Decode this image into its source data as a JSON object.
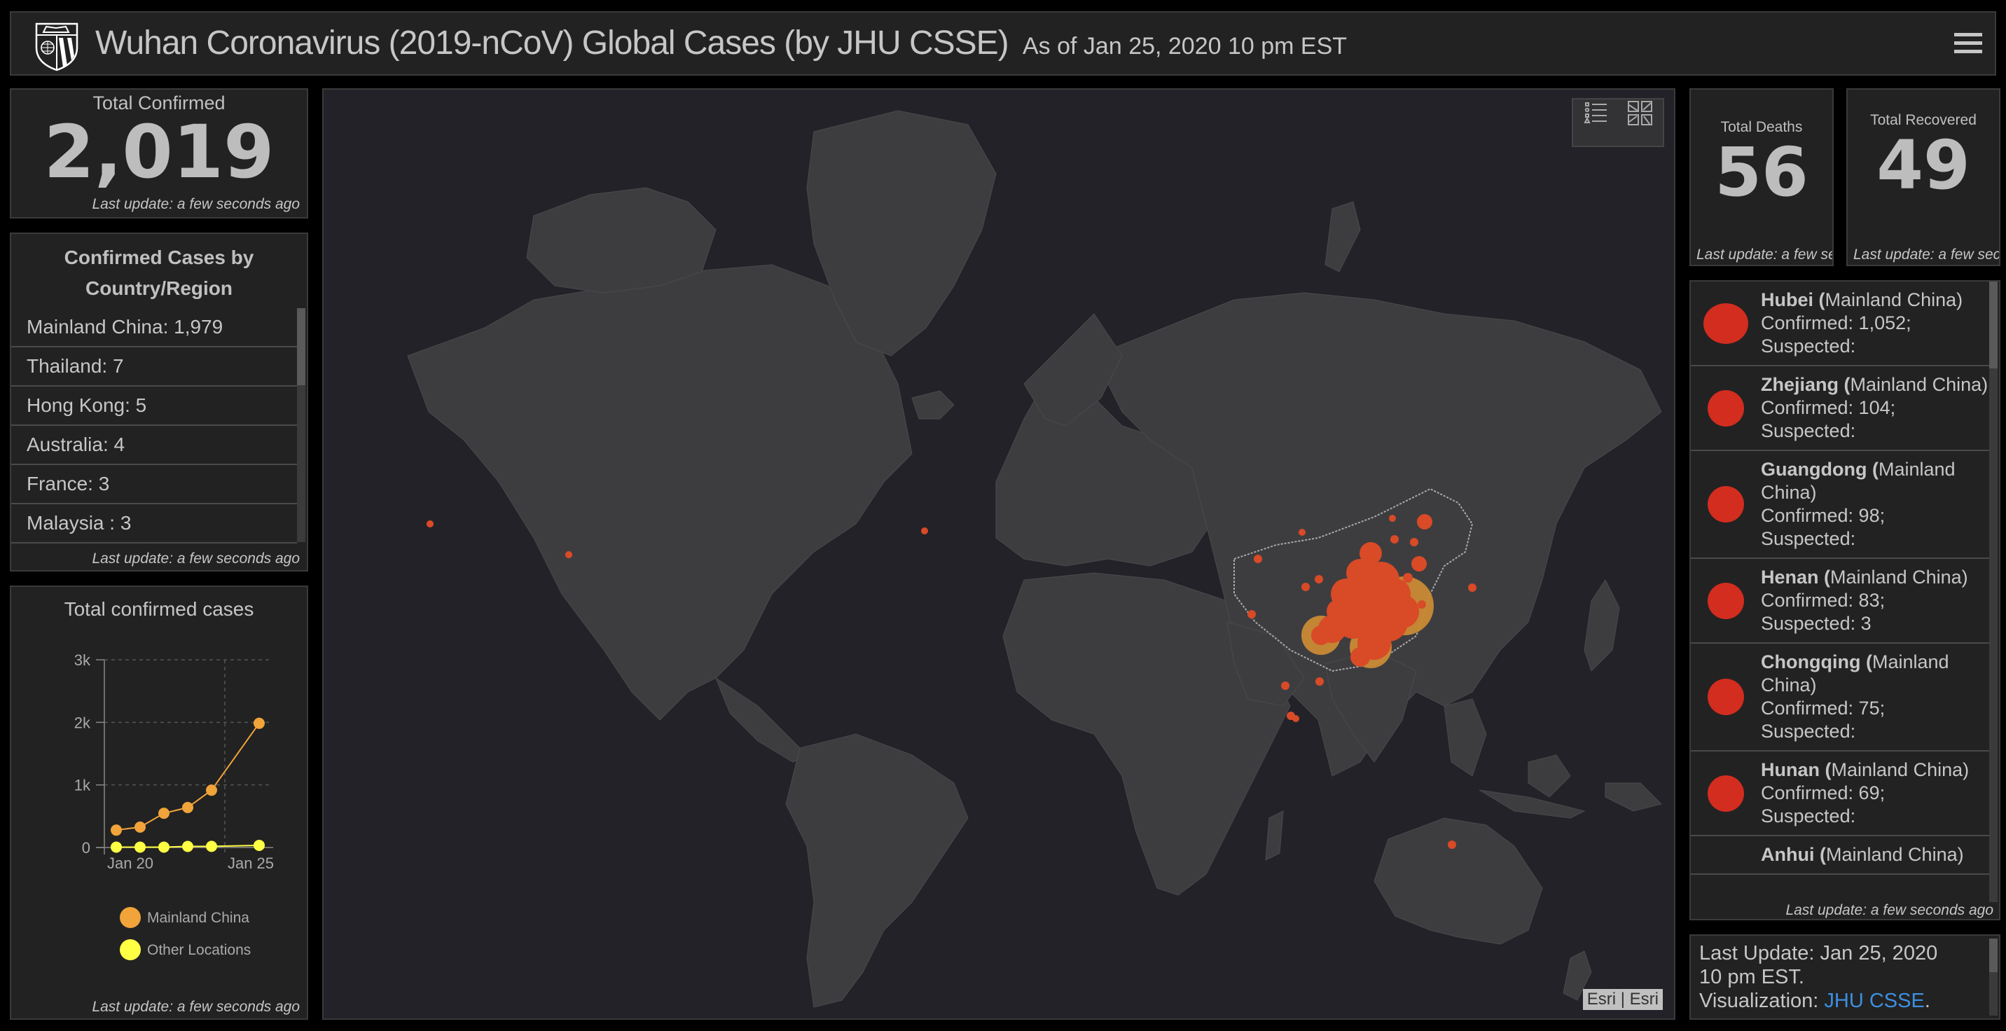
{
  "header": {
    "title": "Wuhan Coronavirus (2019-nCoV) Global Cases (by JHU CSSE)",
    "subtitle": "As of Jan 25, 2020 10 pm EST",
    "logo_icon": "jhu-shield-logo",
    "menu_icon": "hamburger-menu-icon"
  },
  "total_confirmed": {
    "label": "Total Confirmed",
    "value": "2,019",
    "update": "Last update: a few seconds ago"
  },
  "country_list": {
    "title": "Confirmed Cases by Country/Region",
    "items": [
      {
        "label": "Mainland China:  1,979"
      },
      {
        "label": "Thailand:  7"
      },
      {
        "label": "Hong Kong:  5"
      },
      {
        "label": "Australia:  4"
      },
      {
        "label": "France:  3"
      },
      {
        "label": "Malaysia :  3"
      }
    ],
    "update": "Last update: a few seconds ago"
  },
  "chart_panel": {
    "update": "Last update: a few seconds ago"
  },
  "chart_data": {
    "type": "line",
    "title": "Total confirmed cases",
    "xlabel": "",
    "ylabel": "",
    "x": [
      "Jan 20",
      "Jan 21",
      "Jan 22",
      "Jan 23",
      "Jan 24",
      "Jan 25"
    ],
    "x_tick_labels": [
      "Jan 20",
      "Jan 25"
    ],
    "y_tick_labels": [
      "0",
      "1k",
      "2k",
      "3k"
    ],
    "ylim": [
      0,
      3000
    ],
    "grid": true,
    "legend_position": "bottom",
    "series": [
      {
        "name": "Mainland China",
        "color": "#f1a43a",
        "values": [
          278,
          326,
          547,
          639,
          916,
          1985
        ]
      },
      {
        "name": "Other Locations",
        "color": "#ffff44",
        "values": [
          6,
          6,
          6,
          17,
          18,
          34
        ]
      }
    ]
  },
  "map": {
    "widgets": [
      {
        "name": "legend-widget",
        "icon": "legend-list-icon"
      },
      {
        "name": "basemap-gallery-widget",
        "icon": "basemap-gallery-icon"
      }
    ],
    "attribution": "Esri | Esri",
    "colors": {
      "land": "#3d3d40",
      "water": "#222228",
      "case_marker": "#d94a27",
      "suspected_marker": "#c98a35"
    }
  },
  "total_deaths": {
    "label": "Total Deaths",
    "value": "56",
    "update": "Last update: a few seconds ago"
  },
  "total_recovered": {
    "label": "Total Recovered",
    "value": "49",
    "update": "Last update: a few seconds ago"
  },
  "province_list": {
    "items": [
      {
        "name": "Hubei (",
        "region": "Mainland China)",
        "confirmed": "Confirmed: 1,052;",
        "suspected": "Suspected:"
      },
      {
        "name": "Zhejiang (",
        "region": "Mainland China)",
        "confirmed": "Confirmed: 104;",
        "suspected": "Suspected:"
      },
      {
        "name": "Guangdong (",
        "region": "Mainland China)",
        "confirmed": "Confirmed: 98;",
        "suspected": "Suspected:"
      },
      {
        "name": "Henan (",
        "region": "Mainland China)",
        "confirmed": "Confirmed: 83;",
        "suspected": "Suspected: 3"
      },
      {
        "name": "Chongqing (",
        "region": "Mainland China)",
        "confirmed": "Confirmed: 75;",
        "suspected": "Suspected:"
      },
      {
        "name": "Hunan (",
        "region": "Mainland China)",
        "confirmed": "Confirmed: 69;",
        "suspected": "Suspected:"
      },
      {
        "name": "Anhui (",
        "region": "Mainland China)",
        "confirmed": "",
        "suspected": ""
      }
    ],
    "marker_color": "#d22d1f",
    "update": "Last update: a few seconds ago"
  },
  "info_panel": {
    "line1": "Last Update: Jan 25, 2020",
    "line2": "10 pm EST.",
    "line3_prefix": "Visualization: ",
    "link": "JHU CSSE",
    "line3_suffix": ".",
    "link_color": "#3d8fe0"
  }
}
